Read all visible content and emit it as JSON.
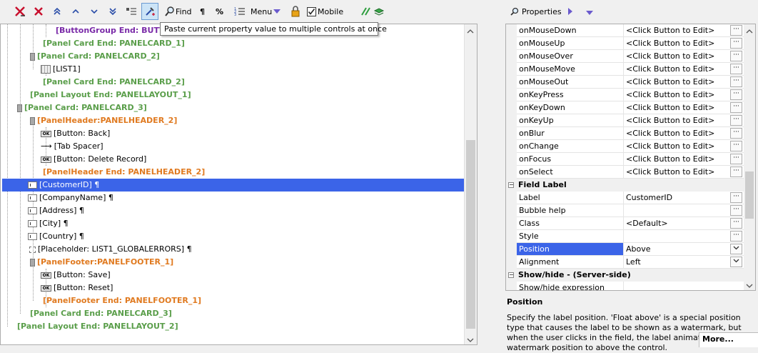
{
  "toolbar": {
    "find_label": "Find",
    "pilcrow_label": "¶",
    "percent_label": "%",
    "menu_label": "Menu",
    "mobile_label": "Mobile",
    "mobile_checked": true,
    "tooltip": "Paste current property value to multiple controls at once"
  },
  "tree": {
    "rows": [
      {
        "text": "[ButtonGroup End: BUTTON",
        "style": "purple"
      },
      {
        "text": "[Panel Card End: PANELCARD_1]",
        "style": "green"
      },
      {
        "text": "[Panel Card: PANELCARD_2]",
        "style": "green"
      },
      {
        "text": "[LIST1]",
        "style": "plain"
      },
      {
        "text": "[Panel Card End: PANELCARD_2]",
        "style": "green"
      },
      {
        "text": "[Panel Layout End: PANELLAYOUT_1]",
        "style": "green"
      },
      {
        "text": "[Panel Card: PANELCARD_3]",
        "style": "green"
      },
      {
        "text": "[PanelHeader:PANELHEADER_2]",
        "style": "orange"
      },
      {
        "text": "[Button: Back]",
        "style": "plain"
      },
      {
        "text": "[Tab Spacer]",
        "style": "plain"
      },
      {
        "text": "[Button: Delete Record]",
        "style": "plain"
      },
      {
        "text": "[PanelHeader End: PANELHEADER_2]",
        "style": "orange"
      },
      {
        "text": "[CustomerID] ¶",
        "style": "selected"
      },
      {
        "text": "[CompanyName] ¶",
        "style": "plain"
      },
      {
        "text": "[Address] ¶",
        "style": "plain"
      },
      {
        "text": "[City] ¶",
        "style": "plain"
      },
      {
        "text": "[Country] ¶",
        "style": "plain"
      },
      {
        "text": "[Placeholder: LIST1_GLOBALERRORS] ¶",
        "style": "plain"
      },
      {
        "text": "[PanelFooter:PANELFOOTER_1]",
        "style": "orange"
      },
      {
        "text": "[Button: Save]",
        "style": "plain"
      },
      {
        "text": "[Button: Reset]",
        "style": "plain"
      },
      {
        "text": "[PanelFooter End: PANELFOOTER_1]",
        "style": "orange"
      },
      {
        "text": "[Panel Card End: PANELCARD_3]",
        "style": "green"
      },
      {
        "text": "[Panel Layout End: PANELLAYOUT_2]",
        "style": "green"
      }
    ]
  },
  "properties": {
    "header_label": "Properties",
    "events": [
      {
        "name": "onMouseDown",
        "value": "<Click Button to Edit>"
      },
      {
        "name": "onMouseUp",
        "value": "<Click Button to Edit>"
      },
      {
        "name": "onMouseOver",
        "value": "<Click Button to Edit>"
      },
      {
        "name": "onMouseMove",
        "value": "<Click Button to Edit>"
      },
      {
        "name": "onMouseOut",
        "value": "<Click Button to Edit>"
      },
      {
        "name": "onKeyPress",
        "value": "<Click Button to Edit>"
      },
      {
        "name": "onKeyDown",
        "value": "<Click Button to Edit>"
      },
      {
        "name": "onKeyUp",
        "value": "<Click Button to Edit>"
      },
      {
        "name": "onBlur",
        "value": "<Click Button to Edit>"
      },
      {
        "name": "onChange",
        "value": "<Click Button to Edit>"
      },
      {
        "name": "onFocus",
        "value": "<Click Button to Edit>"
      },
      {
        "name": "onSelect",
        "value": "<Click Button to Edit>"
      }
    ],
    "field_label_category": "Field Label",
    "field_label": [
      {
        "name": "Label",
        "value": "CustomerID",
        "control": "ellipsis"
      },
      {
        "name": "Bubble help",
        "value": "",
        "control": "ellipsis"
      },
      {
        "name": "Class",
        "value": "<Default>",
        "control": "ellipsis"
      },
      {
        "name": "Style",
        "value": "",
        "control": "ellipsis"
      },
      {
        "name": "Position",
        "value": "Above",
        "control": "dropdown",
        "selected": true
      },
      {
        "name": "Alignment",
        "value": "Left",
        "control": "dropdown"
      }
    ],
    "showhide_category": "Show/hide - (Server-side)",
    "showhide": [
      {
        "name": "Show/hide expression",
        "value": ""
      }
    ]
  },
  "description": {
    "title": "Position",
    "text": "Specify the label position. 'Float above' is a special position type that causes the label to be shown as a watermark, but when the user clicks in the field, the label animates from the watermark position to above the control.",
    "more_label": "More..."
  },
  "colors": {
    "selection": "#3b64e8",
    "green_node": "#5a9e4a",
    "orange_node": "#e07a20",
    "purple_node": "#7a2aa8"
  }
}
